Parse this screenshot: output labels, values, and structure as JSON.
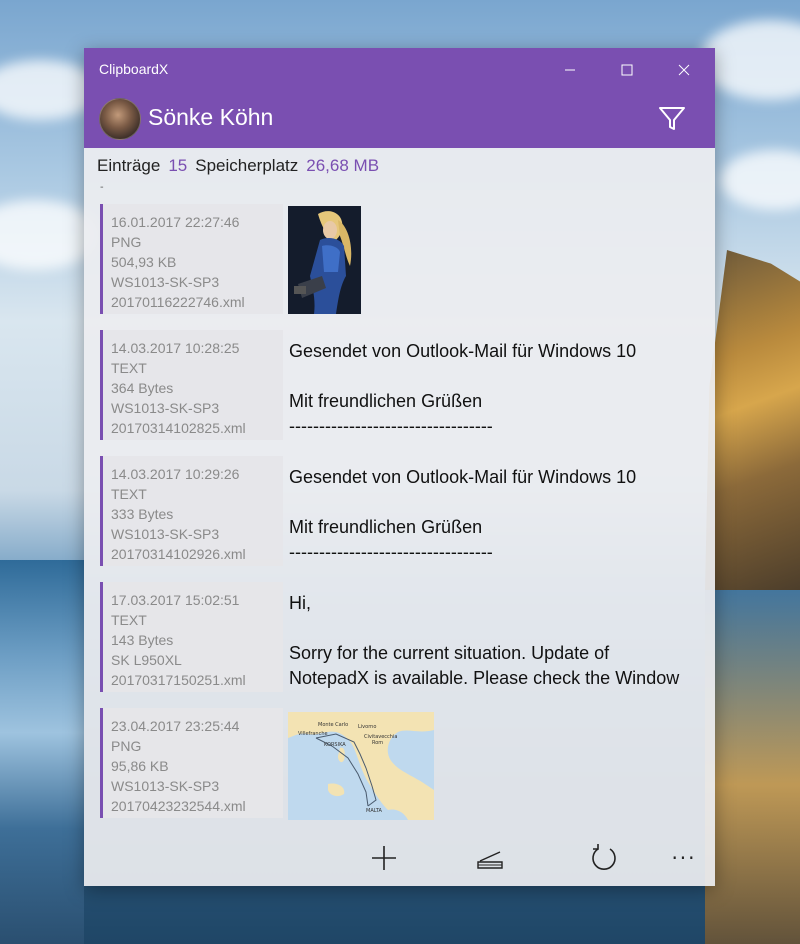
{
  "window": {
    "title": "ClipboardX",
    "minimize_glyph": "—",
    "maximize_glyph": "☐",
    "close_glyph": "✕"
  },
  "header": {
    "user_name": "Sönke Köhn",
    "filter_icon": "filter-icon"
  },
  "stats": {
    "entries_label": "Einträge",
    "entries_value": "15",
    "storage_label": "Speicherplatz",
    "storage_value": "26,68 MB"
  },
  "entries": [
    {
      "meta": [
        "16.01.2017 22:27:46",
        "PNG",
        "504,93 KB",
        "WS1013-SK-SP3",
        "20170116222746.xml"
      ],
      "preview": {
        "kind": "image",
        "image": "figure-image"
      }
    },
    {
      "meta": [
        "14.03.2017 10:28:25",
        "TEXT",
        "364 Bytes",
        "WS1013-SK-SP3",
        "20170314102825.xml"
      ],
      "preview": {
        "kind": "text",
        "lines": [
          "Gesendet von Outlook-Mail für Windows 10",
          "",
          "Mit freundlichen Grüßen",
          "----------------------------------"
        ]
      }
    },
    {
      "meta": [
        "14.03.2017 10:29:26",
        "TEXT",
        "333 Bytes",
        "WS1013-SK-SP3",
        "20170314102926.xml"
      ],
      "preview": {
        "kind": "text",
        "lines": [
          "Gesendet von Outlook-Mail für Windows 10",
          "",
          "Mit freundlichen Grüßen",
          "----------------------------------"
        ]
      }
    },
    {
      "meta": [
        "17.03.2017 15:02:51",
        "TEXT",
        "143 Bytes",
        "SK L950XL",
        "20170317150251.xml"
      ],
      "preview": {
        "kind": "text",
        "lines": [
          "Hi,",
          "",
          "Sorry for the current situation. Update of",
          "NotepadX is available. Please check the Window"
        ]
      }
    },
    {
      "meta": [
        "23.04.2017 23:25:44",
        "PNG",
        "95,86 KB",
        "WS1013-SK-SP3",
        "20170423232544.xml"
      ],
      "preview": {
        "kind": "image",
        "image": "map-image",
        "map_labels": [
          "Monte Carlo",
          "Villefranche",
          "Livorno",
          "Civitavecchia",
          "Rom",
          "KORSIKA",
          "MALTA"
        ]
      }
    }
  ],
  "toolbar": {
    "add": "add-icon",
    "scan": "scanner-icon",
    "refresh": "refresh-icon",
    "more": "···"
  },
  "colors": {
    "accent": "#7a4fb1",
    "meta_text": "#8a8a8a",
    "window_bg": "#ecedf0"
  }
}
